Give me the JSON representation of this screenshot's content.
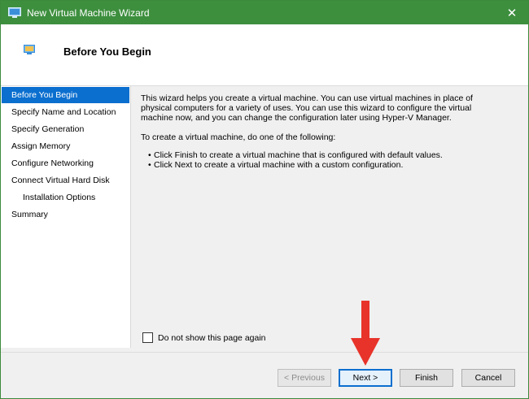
{
  "window": {
    "title": "New Virtual Machine Wizard",
    "close_glyph": "✕",
    "titlebar_color": "#3d8f3e"
  },
  "header": {
    "title": "Before You Begin"
  },
  "sidebar": {
    "items": [
      {
        "label": "Before You Begin"
      },
      {
        "label": "Specify Name and Location"
      },
      {
        "label": "Specify Generation"
      },
      {
        "label": "Assign Memory"
      },
      {
        "label": "Configure Networking"
      },
      {
        "label": "Connect Virtual Hard Disk"
      },
      {
        "label": "Installation Options"
      },
      {
        "label": "Summary"
      }
    ],
    "active_color": "#0b6fcf"
  },
  "content": {
    "intro": "This wizard helps you create a virtual machine. You can use virtual machines in place of physical computers for a variety of uses. You can use this wizard to configure the virtual machine now, and you can change the configuration later using Hyper-V Manager.",
    "instruction": "To create a virtual machine, do one of the following:",
    "bullets": [
      "Click Finish to create a virtual machine that is configured with default values.",
      "Click Next to create a virtual machine with a custom configuration."
    ]
  },
  "options": {
    "dont_show_label": "Do not show this page again",
    "dont_show_checked": false
  },
  "buttons": {
    "previous": "< Previous",
    "next": "Next >",
    "finish": "Finish",
    "cancel": "Cancel"
  },
  "annotation": {
    "arrow_color": "#e8332a",
    "icon": "down-arrow-icon"
  }
}
